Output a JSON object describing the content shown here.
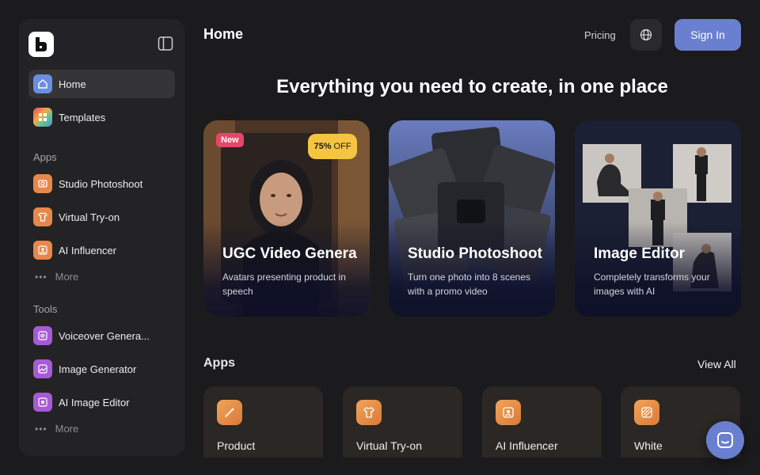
{
  "sidebar": {
    "logo_icon": "brand-logo-icon",
    "collapse_icon": "sidebar-toggle-icon",
    "nav": [
      {
        "label": "Home",
        "icon": "home-icon",
        "active": true
      },
      {
        "label": "Templates",
        "icon": "templates-grid-icon"
      }
    ],
    "apps_label": "Apps",
    "apps": [
      {
        "label": "Studio Photoshoot",
        "icon": "photoshoot-icon"
      },
      {
        "label": "Virtual Try-on",
        "icon": "tshirt-icon"
      },
      {
        "label": "AI Influencer",
        "icon": "influencer-icon"
      }
    ],
    "apps_more": "More",
    "tools_label": "Tools",
    "tools": [
      {
        "label": "Voiceover Genera...",
        "icon": "voiceover-icon"
      },
      {
        "label": "Image Generator",
        "icon": "image-generator-icon"
      },
      {
        "label": "AI Image Editor",
        "icon": "image-editor-icon"
      }
    ],
    "tools_more": "More"
  },
  "header": {
    "title": "Home",
    "pricing": "Pricing",
    "signin": "Sign In"
  },
  "headline": "Everything you need to create, in one place",
  "feature_cards": [
    {
      "title": "UGC Video Genera",
      "desc": "Avatars presenting product in speech",
      "badge_new": "New",
      "badge_discount": "75%",
      "badge_discount_suffix": "OFF"
    },
    {
      "title": "Studio Photoshoot",
      "desc": "Turn one photo into 8 scenes with a promo video"
    },
    {
      "title": "Image Editor",
      "desc": "Completely transforms your images with AI"
    }
  ],
  "apps_section": {
    "title": "Apps",
    "view_all": "View All",
    "items": [
      {
        "label": "Product",
        "icon": "magic-wand-icon"
      },
      {
        "label": "Virtual Try-on",
        "icon": "tshirt-icon"
      },
      {
        "label": "AI Influencer",
        "icon": "influencer-icon"
      },
      {
        "label": "White",
        "icon": "stripes-icon"
      }
    ]
  },
  "colors": {
    "accent": "#6a7fd0",
    "background": "#1b1b1d",
    "sidebar": "#232325",
    "new_badge": "#e5476a",
    "discount_badge": "#f5c542"
  }
}
